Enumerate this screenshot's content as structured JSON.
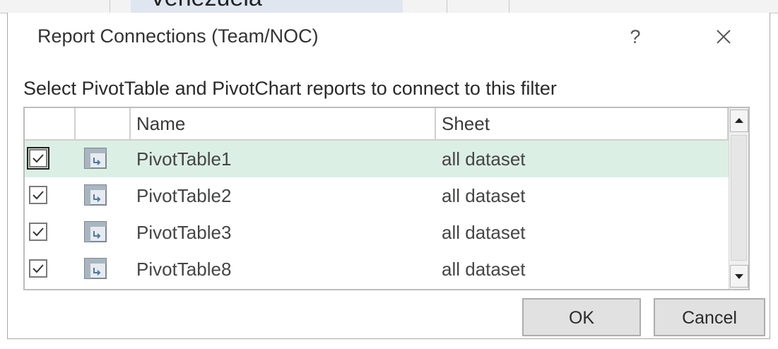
{
  "background": {
    "partial_text": "Venezuela"
  },
  "dialog": {
    "title": "Report Connections (Team/NOC)",
    "help_label": "?",
    "instruction": "Select PivotTable and PivotChart reports to connect to this filter",
    "columns": {
      "name": "Name",
      "sheet": "Sheet"
    },
    "rows": [
      {
        "name": "PivotTable1",
        "sheet": "all dataset",
        "checked": true,
        "selected": true
      },
      {
        "name": "PivotTable2",
        "sheet": "all dataset",
        "checked": true,
        "selected": false
      },
      {
        "name": "PivotTable3",
        "sheet": "all dataset",
        "checked": true,
        "selected": false
      },
      {
        "name": "PivotTable8",
        "sheet": "all dataset",
        "checked": true,
        "selected": false
      }
    ],
    "buttons": {
      "ok": "OK",
      "cancel": "Cancel"
    }
  },
  "colors": {
    "selected_row": "#dcefe4",
    "button_face": "#e1e1e1"
  },
  "icons": {
    "help": "question-mark",
    "close": "close-x",
    "row": "pivot-table-icon",
    "check": "checkmark"
  }
}
